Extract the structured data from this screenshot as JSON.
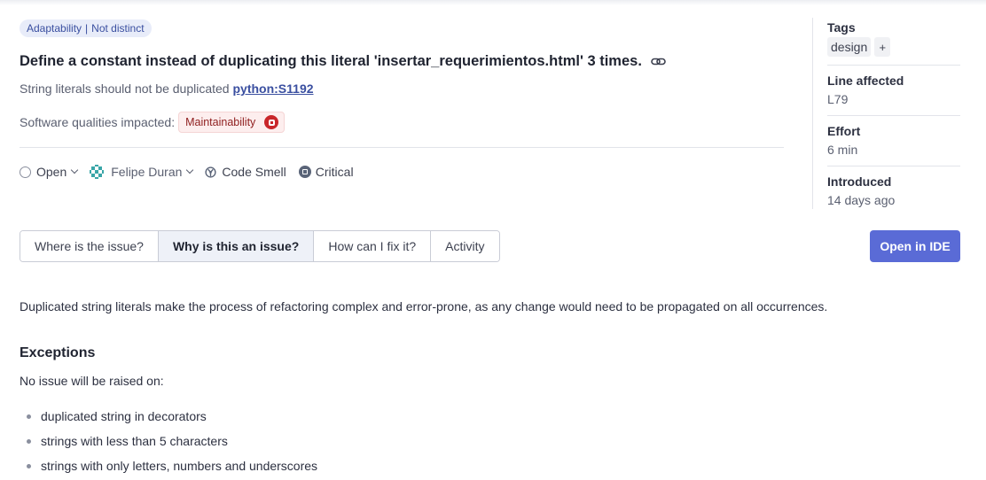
{
  "badge": {
    "category": "Adaptability",
    "attribute": "Not distinct"
  },
  "issue": {
    "title": "Define a constant instead of duplicating this literal 'insertar_requerimientos.html' 3 times.",
    "rule_text": "String literals should not be duplicated",
    "rule_key": "python:S1192",
    "qualities_label": "Software qualities impacted:",
    "quality": "Maintainability"
  },
  "meta": {
    "status": "Open",
    "assignee": "Felipe Duran",
    "type": "Code Smell",
    "severity": "Critical"
  },
  "tabs": [
    {
      "label": "Where is the issue?"
    },
    {
      "label": "Why is this an issue?"
    },
    {
      "label": "How can I fix it?"
    },
    {
      "label": "Activity"
    }
  ],
  "actions": {
    "open_ide": "Open in IDE"
  },
  "sidebar": {
    "tags_label": "Tags",
    "tag": "design",
    "tag_add": "+",
    "line_label": "Line affected",
    "line_value": "L79",
    "effort_label": "Effort",
    "effort_value": "6 min",
    "introduced_label": "Introduced",
    "introduced_value": "14 days ago"
  },
  "content": {
    "description": "Duplicated string literals make the process of refactoring complex and error-prone, as any change would need to be propagated on all occurrences.",
    "exceptions_heading": "Exceptions",
    "exceptions_intro": "No issue will be raised on:",
    "exceptions": [
      "duplicated string in decorators",
      "strings with less than 5 characters",
      "strings with only letters, numbers and underscores"
    ]
  },
  "colors": {
    "accent": "#5a6bd6",
    "maintainability": "#c9262a",
    "badge_bg": "#e8ecf9"
  }
}
